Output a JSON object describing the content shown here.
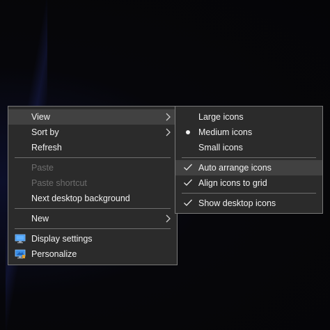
{
  "main_menu": {
    "items": [
      {
        "label": "View",
        "icon": "chevron-right-icon"
      },
      {
        "label": "Sort by",
        "icon": "chevron-right-icon"
      },
      {
        "label": "Refresh"
      },
      {
        "label": "Paste",
        "disabled": true
      },
      {
        "label": "Paste shortcut",
        "disabled": true
      },
      {
        "label": "Next desktop background"
      },
      {
        "label": "New",
        "icon": "chevron-right-icon"
      },
      {
        "label": "Display settings",
        "icon": "display-settings-icon"
      },
      {
        "label": "Personalize",
        "icon": "personalize-icon"
      }
    ]
  },
  "view_submenu": {
    "items": [
      {
        "label": "Large icons"
      },
      {
        "label": "Medium icons",
        "selected": true
      },
      {
        "label": "Small icons"
      },
      {
        "label": "Auto arrange icons",
        "checked": true
      },
      {
        "label": "Align icons to grid",
        "checked": true
      },
      {
        "label": "Show desktop icons",
        "checked": true
      }
    ]
  },
  "colors": {
    "menu_bg": "#2b2b2b",
    "menu_border": "#7a7a7a",
    "hover_bg": "#414141",
    "text": "#f2f2f2",
    "disabled_text": "#6d6d6d"
  }
}
